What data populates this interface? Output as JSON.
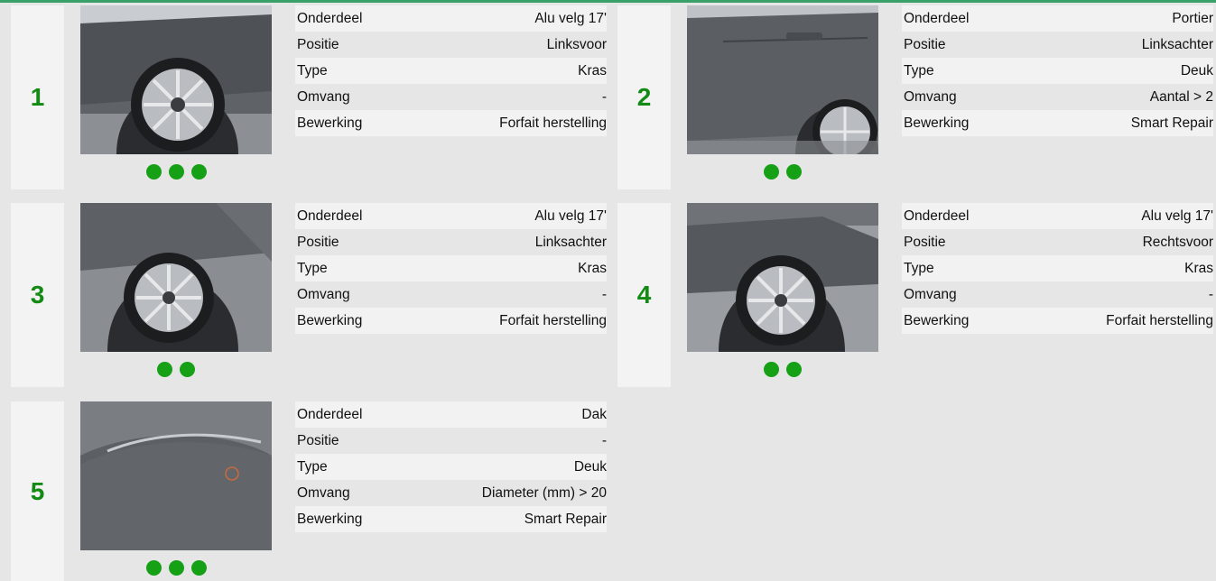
{
  "labels": {
    "part": "Onderdeel",
    "position": "Positie",
    "type": "Type",
    "extent": "Omvang",
    "treatment": "Bewerking"
  },
  "damages": [
    {
      "number": "1",
      "photo_icon": "front-left-wheel-photo",
      "photo_count": 3,
      "part": "Alu velg 17'",
      "position": "Linksvoor",
      "type": "Kras",
      "extent": "-",
      "treatment": "Forfait herstelling"
    },
    {
      "number": "2",
      "photo_icon": "rear-left-door-photo",
      "photo_count": 2,
      "part": "Portier",
      "position": "Linksachter",
      "type": "Deuk",
      "extent": "Aantal > 2",
      "treatment": "Smart Repair"
    },
    {
      "number": "3",
      "photo_icon": "rear-left-wheel-photo",
      "photo_count": 2,
      "part": "Alu velg 17'",
      "position": "Linksachter",
      "type": "Kras",
      "extent": "-",
      "treatment": "Forfait herstelling"
    },
    {
      "number": "4",
      "photo_icon": "front-right-wheel-photo",
      "photo_count": 2,
      "part": "Alu velg 17'",
      "position": "Rechtsvoor",
      "type": "Kras",
      "extent": "-",
      "treatment": "Forfait herstelling"
    },
    {
      "number": "5",
      "photo_icon": "roof-photo",
      "photo_count": 3,
      "part": "Dak",
      "position": "-",
      "type": "Deuk",
      "extent": "Diameter (mm) > 20",
      "treatment": "Smart Repair"
    }
  ],
  "colors": {
    "accent_green": "#138a14",
    "dot_green": "#16a016",
    "top_bar": "#3aa06a"
  }
}
